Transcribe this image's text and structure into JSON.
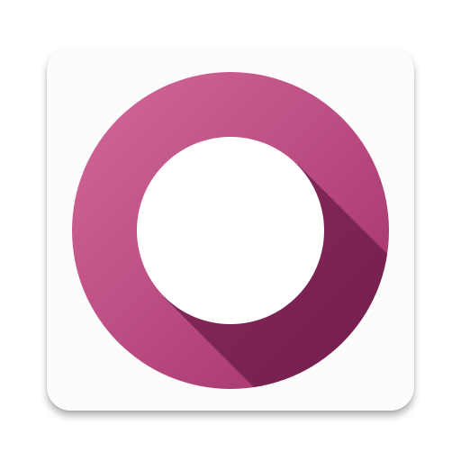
{
  "app_icon": {
    "icon_name": "ring-logo-icon",
    "colors": {
      "tile_background": "#fcfcfc",
      "ring_light": "#d0608f",
      "ring_dark": "#a8386f",
      "long_shadow": "#7a1f53",
      "center_hole": "#ffffff"
    }
  }
}
